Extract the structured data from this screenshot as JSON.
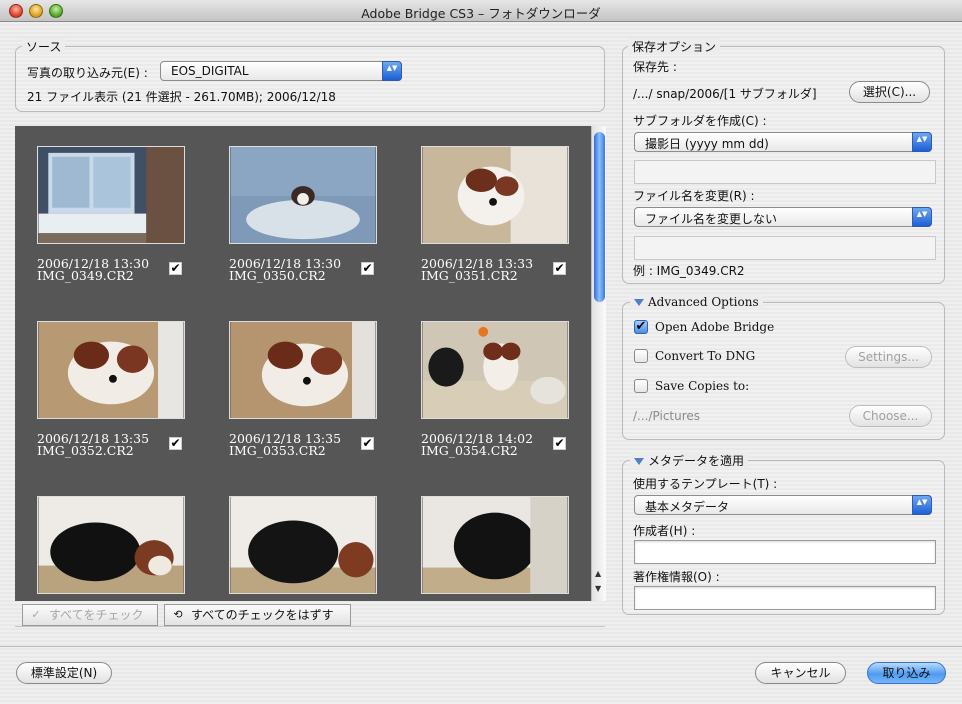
{
  "window": {
    "title": "Adobe Bridge CS3 – フォトダウンローダ"
  },
  "source": {
    "group_title": "ソース",
    "import_label": "写真の取り込み元(E) :",
    "import_value": "EOS_DIGITAL",
    "summary": "21 ファイル表示 (21 件選択 - 261.70MB); 2006/12/18"
  },
  "thumbnails": [
    {
      "date": "2006/12/18 13:30",
      "file": "IMG_0349.CR2",
      "checked": true
    },
    {
      "date": "2006/12/18 13:30",
      "file": "IMG_0350.CR2",
      "checked": true
    },
    {
      "date": "2006/12/18 13:33",
      "file": "IMG_0351.CR2",
      "checked": true
    },
    {
      "date": "2006/12/18 13:35",
      "file": "IMG_0352.CR2",
      "checked": true
    },
    {
      "date": "2006/12/18 13:35",
      "file": "IMG_0353.CR2",
      "checked": true
    },
    {
      "date": "2006/12/18 14:02",
      "file": "IMG_0354.CR2",
      "checked": true
    }
  ],
  "checks": {
    "mark": "✔"
  },
  "grid_buttons": {
    "check_all": "すべてをチェック",
    "uncheck_all": "すべてのチェックをはずす"
  },
  "save_options": {
    "group_title": "保存オプション",
    "dest_label": "保存先 :",
    "dest_path": "/.../ snap/2006/[1 サブフォルダ]",
    "choose_button": "選択(C)...",
    "subfolder_label": "サブフォルダを作成(C) :",
    "subfolder_value": "撮影日 (yyyy mm dd)",
    "rename_label": "ファイル名を変更(R) :",
    "rename_value": "ファイル名を変更しない",
    "example": "例 : IMG_0349.CR2"
  },
  "advanced": {
    "group_title": "Advanced Options",
    "open_bridge": "Open Adobe Bridge",
    "open_bridge_checked": true,
    "convert_dng": "Convert To DNG",
    "convert_dng_checked": false,
    "settings_button": "Settings...",
    "save_copies": "Save Copies to:",
    "save_copies_checked": false,
    "copies_path": "/.../Pictures",
    "choose_button": "Choose..."
  },
  "metadata": {
    "group_title": "メタデータを適用",
    "template_label": "使用するテンプレート(T) :",
    "template_value": "基本メタデータ",
    "author_label": "作成者(H) :",
    "author_value": "",
    "copyright_label": "著作権情報(O) :",
    "copyright_value": ""
  },
  "footer": {
    "defaults_button": "標準設定(N)",
    "cancel_button": "キャンセル",
    "import_button": "取り込み"
  },
  "colors": {
    "accent": "#4a8ee6",
    "grid_bg": "#565656"
  },
  "icons": {
    "popup_arrows": "▲▼",
    "scroll_up": "▲",
    "scroll_down": "▼",
    "check_all_icon": "✓",
    "uncheck_all_icon": "⟲"
  }
}
